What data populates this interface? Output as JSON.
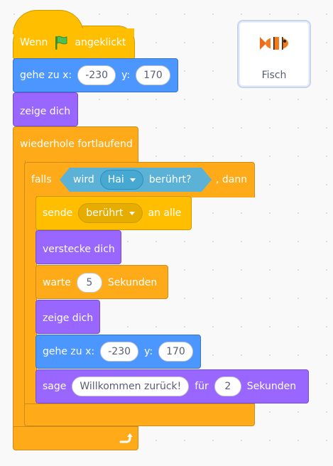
{
  "sprite": {
    "name": "Fisch",
    "icon": "clownfish-icon"
  },
  "script": {
    "hat": {
      "prefix": "Wenn",
      "flag_icon": "green-flag-icon",
      "suffix": "angeklickt"
    },
    "goto1": {
      "label": "gehe zu x:",
      "x": "-230",
      "ylabel": "y:",
      "y": "170"
    },
    "show1": {
      "label": "zeige dich"
    },
    "forever": {
      "label": "wiederhole fortlaufend",
      "loop_icon": "loop-arrow-icon"
    },
    "if": {
      "prefix": "falls",
      "sensing": {
        "prefix": "wird",
        "target": "Hai",
        "suffix": "berührt?"
      },
      "suffix": ", dann"
    },
    "broadcast": {
      "prefix": "sende",
      "message": "berührt",
      "suffix": "an alle"
    },
    "hide": {
      "label": "verstecke dich"
    },
    "wait": {
      "prefix": "warte",
      "value": "5",
      "suffix": "Sekunden"
    },
    "show2": {
      "label": "zeige dich"
    },
    "goto2": {
      "label": "gehe zu x:",
      "x": "-230",
      "ylabel": "y:",
      "y": "170"
    },
    "say": {
      "prefix": "sage",
      "message": "Willkommen zurück!",
      "mid": "für",
      "secs": "2",
      "suffix": "Sekunden"
    }
  },
  "colors": {
    "events": "#ffbf00",
    "control": "#ffab19",
    "motion": "#4c97ff",
    "looks": "#9966ff",
    "sensing": "#5cb1d6"
  }
}
